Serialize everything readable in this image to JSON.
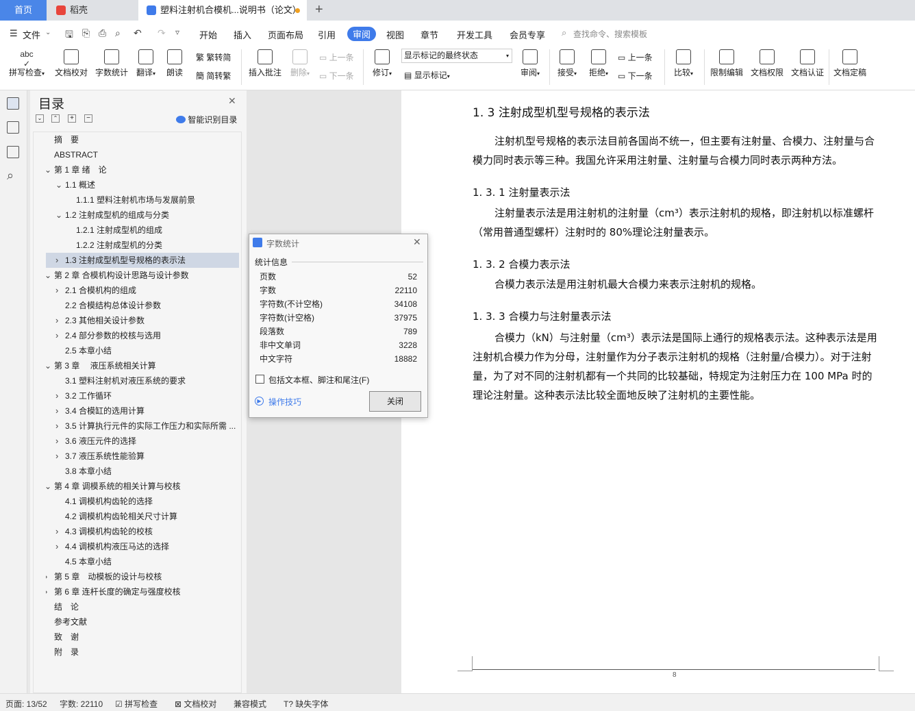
{
  "tabs": {
    "home": "首页",
    "straw": "稻壳",
    "doc": "塑料注射机合模机...说明书（论文）"
  },
  "menu": {
    "file": "文件",
    "items": [
      "开始",
      "插入",
      "页面布局",
      "引用",
      "审阅",
      "视图",
      "章节",
      "开发工具",
      "会员专享"
    ],
    "active": "审阅",
    "search_placeholder": "查找命令、搜索模板"
  },
  "ribbon": {
    "spell": "拼写检查",
    "proof": "文档校对",
    "wordcount": "字数统计",
    "translate": "翻译",
    "read": "朗读",
    "trad": "繁转简",
    "simp": "简转繁",
    "comment": "插入批注",
    "delete": "删除",
    "prev": "上一条",
    "next": "下一条",
    "revise": "修订",
    "status_select": "显示标记的最终状态",
    "show_marks": "显示标记",
    "review": "审阅",
    "accept": "接受",
    "reject": "拒绝",
    "prev2": "上一条",
    "next2": "下一条",
    "compare": "比较",
    "restrict": "限制编辑",
    "perm": "文档权限",
    "auth": "文档认证",
    "final": "文档定稿"
  },
  "toc": {
    "title": "目录",
    "smart": "智能识别目录",
    "items": [
      {
        "t": "摘　要",
        "lv": 0,
        "c": ""
      },
      {
        "t": "ABSTRACT",
        "lv": 0,
        "c": ""
      },
      {
        "t": "第 1 章  绪　论",
        "lv": 0,
        "c": "v"
      },
      {
        "t": "1.1 概述",
        "lv": 1,
        "c": "v"
      },
      {
        "t": "1.1.1 塑料注射机市场与发展前景",
        "lv": 2,
        "c": ""
      },
      {
        "t": "1.2 注射成型机的组成与分类",
        "lv": 1,
        "c": "v"
      },
      {
        "t": "1.2.1 注射成型机的组成",
        "lv": 2,
        "c": ""
      },
      {
        "t": "1.2.2  注射成型机的分类",
        "lv": 2,
        "c": ""
      },
      {
        "t": "1.3 注射成型机型号规格的表示法",
        "lv": 1,
        "c": ">",
        "sel": true
      },
      {
        "t": "第 2 章  合模机构设计思路与设计参数",
        "lv": 0,
        "c": "v"
      },
      {
        "t": "2.1 合模机构的组成",
        "lv": 1,
        "c": ">"
      },
      {
        "t": "2.2 合模结构总体设计参数",
        "lv": 1,
        "c": ""
      },
      {
        "t": "2.3 其他相关设计参数",
        "lv": 1,
        "c": ">"
      },
      {
        "t": "2.4 部分参数的校核与选用",
        "lv": 1,
        "c": ">"
      },
      {
        "t": "2.5 本章小结",
        "lv": 1,
        "c": ""
      },
      {
        "t": "第 3 章　 液压系统相关计算",
        "lv": 0,
        "c": "v"
      },
      {
        "t": "3.1 塑料注射机对液压系统的要求",
        "lv": 1,
        "c": ""
      },
      {
        "t": "3.2 工作循环",
        "lv": 1,
        "c": ">"
      },
      {
        "t": "3.4 合模缸的选用计算",
        "lv": 1,
        "c": ">"
      },
      {
        "t": "3.5 计算执行元件的实际工作压力和实际所需 ...",
        "lv": 1,
        "c": ">"
      },
      {
        "t": "3.6 液压元件的选择",
        "lv": 1,
        "c": ">"
      },
      {
        "t": "3.7 液压系统性能验算",
        "lv": 1,
        "c": ">"
      },
      {
        "t": "3.8 本章小结",
        "lv": 1,
        "c": ""
      },
      {
        "t": "第 4 章  调模系统的相关计算与校核",
        "lv": 0,
        "c": "v"
      },
      {
        "t": "4.1 调模机构齿轮的选择",
        "lv": 1,
        "c": ""
      },
      {
        "t": "4.2 调模机构齿轮相关尺寸计算",
        "lv": 1,
        "c": ""
      },
      {
        "t": "4.3 调模机构齿轮的校核",
        "lv": 1,
        "c": ">"
      },
      {
        "t": "4.4 调模机构液压马达的选择",
        "lv": 1,
        "c": ">"
      },
      {
        "t": "4.5 本章小结",
        "lv": 1,
        "c": ""
      },
      {
        "t": "第 5 章　动模板的设计与校核",
        "lv": 0,
        "c": ">"
      },
      {
        "t": "第 6 章  连杆长度的确定与强度校核",
        "lv": 0,
        "c": ">"
      },
      {
        "t": "结　论",
        "lv": 0,
        "c": ""
      },
      {
        "t": "参考文献",
        "lv": 0,
        "c": ""
      },
      {
        "t": "致　谢",
        "lv": 0,
        "c": ""
      },
      {
        "t": "附　录",
        "lv": 0,
        "c": ""
      }
    ]
  },
  "dialog": {
    "title": "字数统计",
    "section": "统计信息",
    "rows": [
      [
        "页数",
        "52"
      ],
      [
        "字数",
        "22110"
      ],
      [
        "字符数(不计空格)",
        "34108"
      ],
      [
        "字符数(计空格)",
        "37975"
      ],
      [
        "段落数",
        "789"
      ],
      [
        "非中文单词",
        "3228"
      ],
      [
        "中文字符",
        "18882"
      ]
    ],
    "checkbox": "包括文本框、脚注和尾注(F)",
    "tips": "操作技巧",
    "close": "关闭"
  },
  "doc": {
    "h2": "1. 3 注射成型机型号规格的表示法",
    "p1": "注射机型号规格的表示法目前各国尚不统一，但主要有注射量、合模力、注射量与合模力同时表示等三种。我国允许采用注射量、注射量与合模力同时表示两种方法。",
    "h3a": "1. 3. 1 注射量表示法",
    "p2": "注射量表示法是用注射机的注射量（cm³）表示注射机的规格，即注射机以标准螺杆（常用普通型螺杆）注射时的 80%理论注射量表示。",
    "h3b": "1. 3. 2 合模力表示法",
    "p3": "合模力表示法是用注射机最大合模力来表示注射机的规格。",
    "h3c": "1. 3. 3 合模力与注射量表示法",
    "p4": "合模力（kN）与注射量（cm³）表示法是国际上通行的规格表示法。这种表示法是用注射机合模力作为分母，注射量作为分子表示注射机的规格（注射量/合模力）。对于注射量，为了对不同的注射机都有一个共同的比较基础，特规定为注射压力在 100 MPa 时的理论注射量。这种表示法比较全面地反映了注射机的主要性能。",
    "page_no": "8"
  },
  "status": {
    "page": "页面: 13/52",
    "words": "字数: 22110",
    "spell": "拼写检查",
    "proof": "文档校对",
    "compat": "兼容模式",
    "missing_font": "缺失字体"
  }
}
